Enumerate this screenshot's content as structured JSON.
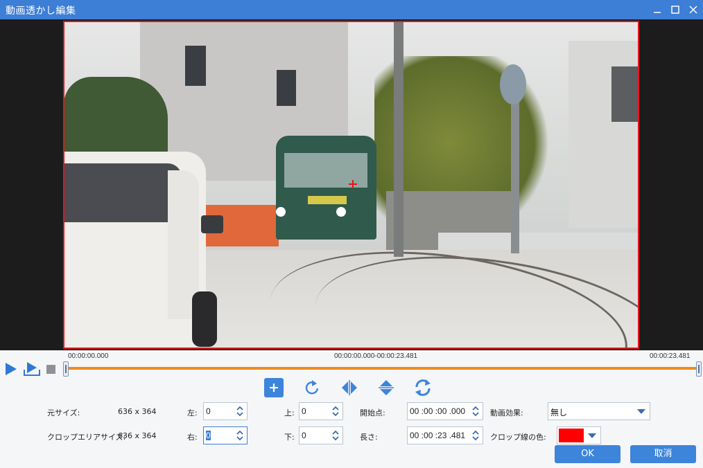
{
  "window": {
    "title": "動画透かし編集",
    "minimize_icon": "minimize-icon",
    "maximize_icon": "maximize-icon",
    "close_icon": "close-icon"
  },
  "timeline": {
    "start_time": "00:00:00.000",
    "range": "00:00:00.000-00:00:23.481",
    "end_time": "00:00:23.481"
  },
  "playback": {
    "play_icon": "play-icon",
    "play_clip_icon": "play-clip-icon",
    "stop_icon": "stop-icon"
  },
  "tools": [
    "add-icon",
    "rotate-icon",
    "flip-horizontal-icon",
    "flip-vertical-icon",
    "reset-icon"
  ],
  "form": {
    "original_size_label": "元サイズ:",
    "original_size_value": "636 x 364",
    "crop_area_size_label": "クロップエリアサイズ:",
    "crop_area_size_value": "636 x 364",
    "left_label": "左:",
    "left_value": "0",
    "right_label": "右:",
    "right_value": "0",
    "top_label": "上:",
    "top_value": "0",
    "bottom_label": "下:",
    "bottom_value": "0",
    "start_point_label": "開始点:",
    "start_point_value": "00 :00 :00 .000",
    "length_label": "長さ:",
    "length_value": "00 :00 :23 .481",
    "video_effect_label": "動画効果:",
    "video_effect_value": "無し",
    "crop_line_color_label": "クロップ線の色:",
    "crop_line_color": "#ff0000"
  },
  "buttons": {
    "ok": "OK",
    "cancel": "取消"
  },
  "colors": {
    "accent": "#3d7ed6",
    "timeline": "#f08a1c",
    "crop_border": "#e8141b"
  }
}
